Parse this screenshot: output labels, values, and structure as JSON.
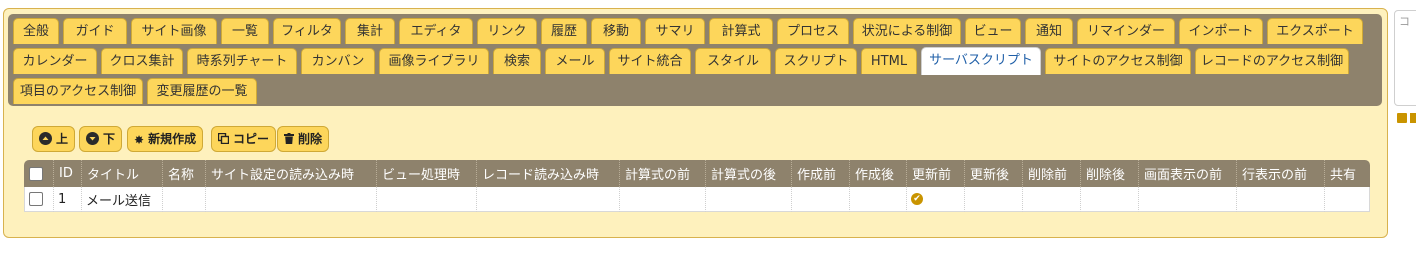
{
  "tabs": {
    "row1": [
      "全般",
      "ガイド",
      "サイト画像",
      "一覧",
      "フィルタ",
      "集計",
      "エディタ",
      "リンク",
      "履歴",
      "移動",
      "サマリ",
      "計算式",
      "プロセス",
      "状況による制御",
      "ビュー",
      "通知",
      "リマインダー",
      "インポート",
      "エクスポート"
    ],
    "row2": [
      "カレンダー",
      "クロス集計",
      "時系列チャート",
      "カンバン",
      "画像ライブラリ",
      "検索",
      "メール",
      "サイト統合",
      "スタイル",
      "スクリプト",
      "HTML",
      "サーバスクリプト",
      "サイトのアクセス制御",
      "レコードのアクセス制御"
    ],
    "row3": [
      "項目のアクセス制御",
      "変更履歴の一覧"
    ],
    "active": "サーバスクリプト"
  },
  "toolbar": {
    "up_label": "上",
    "down_label": "下",
    "new_label": "新規作成",
    "copy_label": "コピー",
    "delete_label": "削除"
  },
  "grid": {
    "columns": [
      "ID",
      "タイトル",
      "名称",
      "サイト設定の読み込み時",
      "ビュー処理時",
      "レコード読み込み時",
      "計算式の前",
      "計算式の後",
      "作成前",
      "作成後",
      "更新前",
      "更新後",
      "削除前",
      "削除後",
      "画面表示の前",
      "行表示の前",
      "共有"
    ],
    "rows": [
      {
        "id": "1",
        "title": "メール送信",
        "checked_column": "更新前"
      }
    ]
  },
  "side": {
    "text": "コ"
  },
  "colors": {
    "accent": "#fdd65b",
    "header": "#8e826c",
    "panel": "#fef1bd",
    "active_tab_text": "#1f5fa8"
  }
}
